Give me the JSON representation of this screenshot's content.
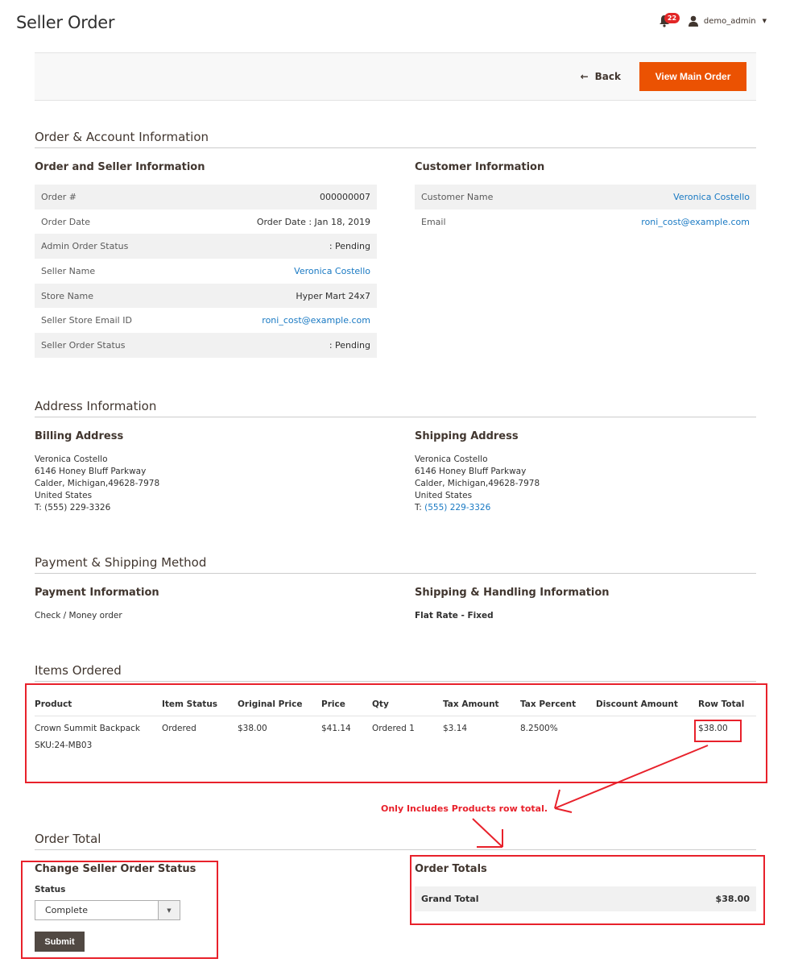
{
  "page": {
    "title": "Seller Order"
  },
  "header": {
    "notifications_count": "22",
    "username": "demo_admin"
  },
  "toolbar": {
    "back_label": "Back",
    "view_main_order_label": "View Main Order"
  },
  "order_account": {
    "section_title": "Order & Account Information",
    "order_seller": {
      "title": "Order and Seller Information",
      "rows": [
        {
          "label": "Order #",
          "value": "000000007"
        },
        {
          "label": "Order Date",
          "value": "Order Date : Jan 18, 2019"
        },
        {
          "label": "Admin Order Status",
          "value": ": Pending"
        },
        {
          "label": "Seller Name",
          "value": "Veronica Costello"
        },
        {
          "label": "Store Name",
          "value": "Hyper Mart 24x7"
        },
        {
          "label": "Seller Store Email ID",
          "value": "roni_cost@example.com"
        },
        {
          "label": "Seller Order Status",
          "value": ": Pending"
        }
      ]
    },
    "customer": {
      "title": "Customer Information",
      "rows": [
        {
          "label": "Customer Name",
          "value": "Veronica Costello"
        },
        {
          "label": "Email",
          "value": "roni_cost@example.com"
        }
      ]
    }
  },
  "address": {
    "section_title": "Address Information",
    "billing": {
      "title": "Billing Address",
      "lines": [
        "Veronica Costello",
        "6146 Honey Bluff Parkway",
        "Calder, Michigan,49628-7978",
        "United States"
      ],
      "phone_prefix": "T: ",
      "phone": "(555) 229-3326"
    },
    "shipping": {
      "title": "Shipping Address",
      "lines": [
        "Veronica Costello",
        "6146 Honey Bluff Parkway",
        "Calder, Michigan,49628-7978",
        "United States"
      ],
      "phone_prefix": "T: ",
      "phone": "(555) 229-3326"
    }
  },
  "payment_shipping": {
    "section_title": "Payment & Shipping Method",
    "payment": {
      "title": "Payment Information",
      "method": "Check / Money order"
    },
    "shipping": {
      "title": "Shipping & Handling Information",
      "method": "Flat Rate - Fixed"
    }
  },
  "items": {
    "section_title": "Items Ordered",
    "columns": [
      "Product",
      "Item Status",
      "Original Price",
      "Price",
      "Qty",
      "Tax Amount",
      "Tax Percent",
      "Discount Amount",
      "Row Total"
    ],
    "rows": [
      {
        "product": "Crown Summit Backpack",
        "sku": "SKU:24-MB03",
        "item_status": "Ordered",
        "original_price": "$38.00",
        "price": "$41.14",
        "qty": "Ordered 1",
        "tax_amount": "$3.14",
        "tax_percent": "8.2500%",
        "discount_amount": "",
        "row_total": "$38.00"
      }
    ]
  },
  "order_total": {
    "section_title": "Order Total",
    "change_status": {
      "title": "Change Seller Order Status",
      "status_label": "Status",
      "status_value": "Complete",
      "submit_label": "Submit"
    },
    "totals": {
      "title": "Order Totals",
      "grand_total_label": "Grand Total",
      "grand_total_value": "$38.00"
    }
  },
  "annotation": {
    "text": "Only Includes Products row total.",
    "color": "#e8212b"
  },
  "colors": {
    "accent": "#eb5202",
    "link": "#1979c3",
    "submit": "#514943",
    "badge": "#e22626"
  }
}
